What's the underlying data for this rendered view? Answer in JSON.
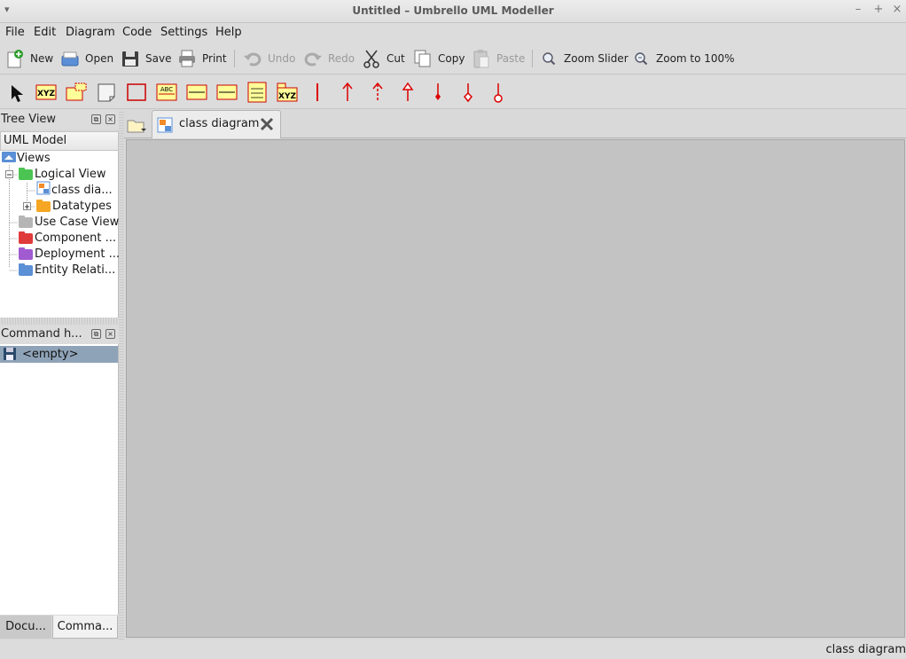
{
  "window": {
    "title": "Untitled – Umbrello UML Modeller"
  },
  "menu": [
    "File",
    "Edit",
    "Diagram",
    "Code",
    "Settings",
    "Help"
  ],
  "toolbar": {
    "new": "New",
    "open": "Open",
    "save": "Save",
    "print": "Print",
    "undo": "Undo",
    "redo": "Redo",
    "cut": "Cut",
    "copy": "Copy",
    "paste": "Paste",
    "zoom_slider": "Zoom Slider",
    "zoom_100": "Zoom to 100%"
  },
  "diagram_tools": {
    "class_text": "XYZ",
    "abc": "ABC",
    "template_text": "XYZ",
    "colors": {
      "box_fill": "#ffff99",
      "box_border": "#cc0000",
      "association": "#dd0000"
    }
  },
  "tree_view": {
    "title": "Tree View",
    "header": "UML Model",
    "items": [
      {
        "label": "Views"
      },
      {
        "label": "Logical View"
      },
      {
        "label": "class dia..."
      },
      {
        "label": "Datatypes"
      },
      {
        "label": "Use Case View"
      },
      {
        "label": "Component ..."
      },
      {
        "label": "Deployment ..."
      },
      {
        "label": "Entity Relati..."
      }
    ]
  },
  "command_history": {
    "title": "Command h...",
    "entry": "<empty>"
  },
  "bottom_tabs": [
    "Docu...",
    "Comma..."
  ],
  "document_tab": {
    "label": "class diagram"
  },
  "status": {
    "text": "class diagram"
  }
}
